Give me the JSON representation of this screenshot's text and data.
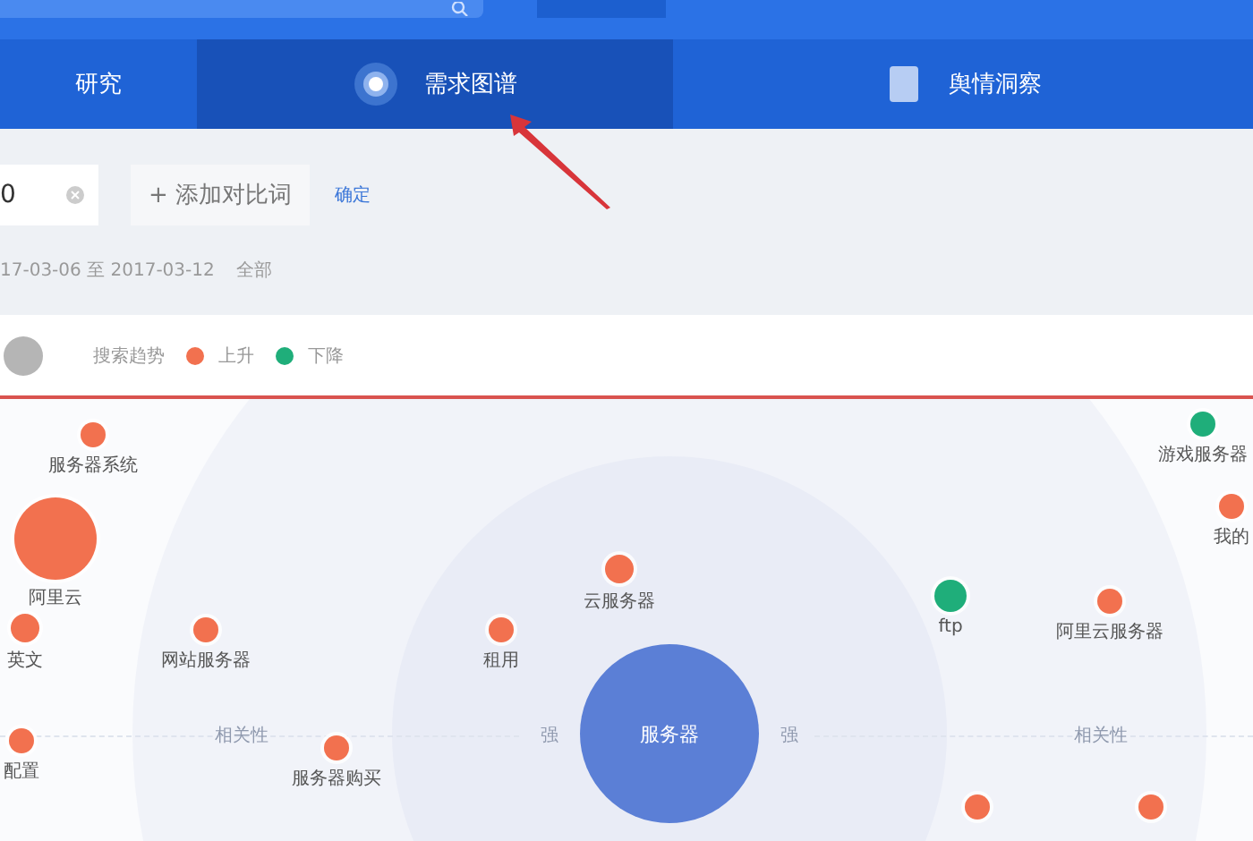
{
  "tabs": [
    {
      "label": "研究",
      "selected": false
    },
    {
      "label": "需求图谱",
      "selected": true
    },
    {
      "label": "舆情洞察",
      "selected": false
    }
  ],
  "toolbar": {
    "keyword_value": "0",
    "add_compare": "+ 添加对比词",
    "confirm": "确定"
  },
  "date_range": {
    "range": "17-03-06 至 2017-03-12",
    "scope": "全部"
  },
  "legend": {
    "title": "搜索趋势",
    "items": [
      {
        "label": "上升",
        "color": "#f2714f"
      },
      {
        "label": "下降",
        "color": "#1fae7a"
      }
    ]
  },
  "graph": {
    "center": "服务器",
    "axis_labels": [
      "相关性",
      "强",
      "强",
      "相关性"
    ],
    "nodes": [
      {
        "label": "服务器系统",
        "color": "#f2714f"
      },
      {
        "label": "阿里云",
        "color": "#f2714f"
      },
      {
        "label": "英文",
        "color": "#f2714f"
      },
      {
        "label": "配置",
        "color": "#f2714f"
      },
      {
        "label": "网站服务器",
        "color": "#f2714f"
      },
      {
        "label": "服务器购买",
        "color": "#f2714f"
      },
      {
        "label": "租用",
        "color": "#f2714f"
      },
      {
        "label": "云服务器",
        "color": "#f2714f"
      },
      {
        "label": "ftp",
        "color": "#1fae7a"
      },
      {
        "label": "阿里云服务器",
        "color": "#f2714f"
      },
      {
        "label": "游戏服务器",
        "color": "#1fae7a"
      },
      {
        "label": "我的",
        "color": "#f2714f"
      },
      {
        "color": "#f2714f"
      },
      {
        "color": "#f2714f"
      }
    ]
  }
}
